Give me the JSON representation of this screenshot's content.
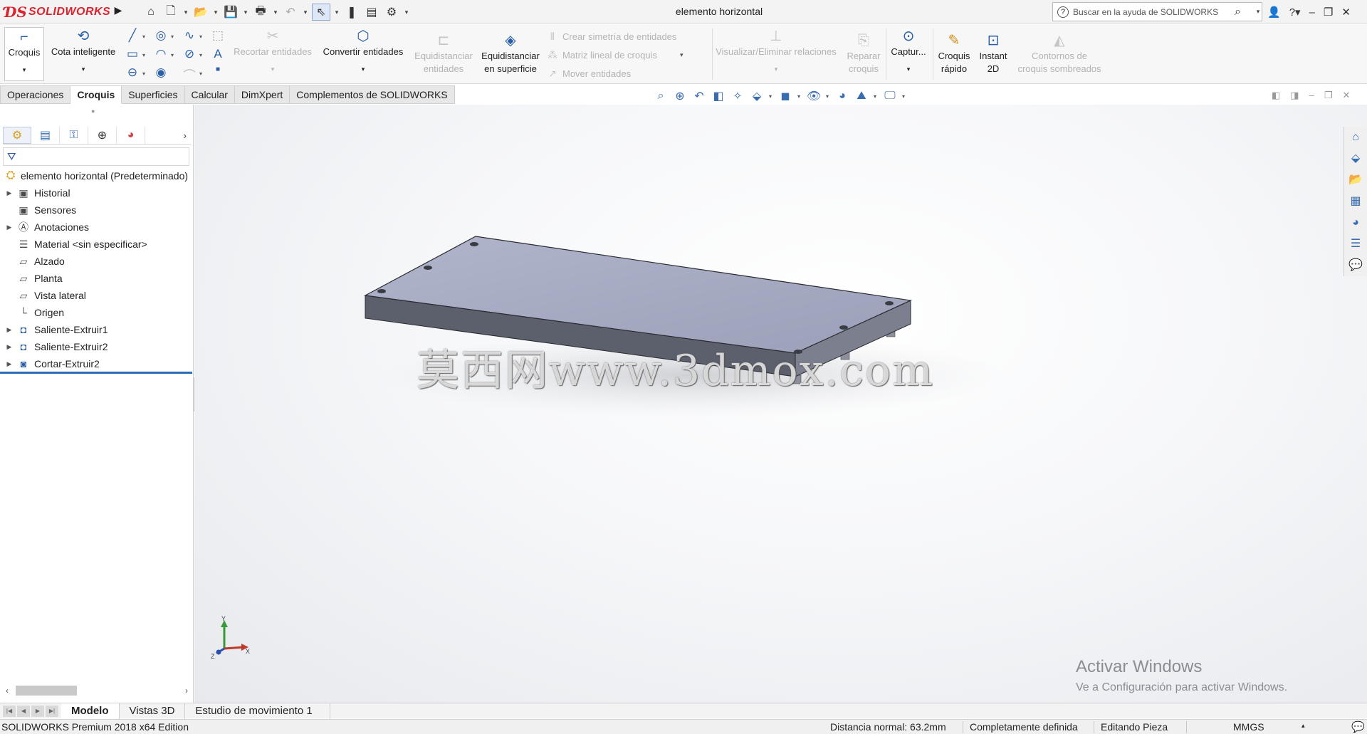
{
  "app": {
    "brand": "SOLIDWORKS",
    "document_title": "elemento horizontal",
    "search_placeholder": "Buscar en la ayuda de SOLIDWORKS"
  },
  "ribbon": {
    "croquis": "Croquis",
    "cota": "Cota inteligente",
    "recortar": "Recortar entidades",
    "convertir": "Convertir entidades",
    "equid_ent_1": "Equidistanciar",
    "equid_ent_2": "entidades",
    "equid_sup_1": "Equidistanciar",
    "equid_sup_2": "en superficie",
    "simetria": "Crear simetría de entidades",
    "matriz": "Matriz lineal de croquis",
    "mover": "Mover entidades",
    "relaciones": "Visualizar/Eliminar relaciones",
    "reparar_1": "Reparar",
    "reparar_2": "croquis",
    "captura": "Captur...",
    "rapido_1": "Croquis",
    "rapido_2": "rápido",
    "instant_1": "Instant",
    "instant_2": "2D",
    "contornos_1": "Contornos de",
    "contornos_2": "croquis sombreados"
  },
  "command_tabs": [
    "Operaciones",
    "Croquis",
    "Superficies",
    "Calcular",
    "DimXpert",
    "Complementos de SOLIDWORKS"
  ],
  "feature_tree": {
    "root": "elemento horizontal  (Predeterminado)",
    "items": [
      {
        "label": "Historial",
        "icon": "history-folder-icon",
        "expandable": true
      },
      {
        "label": "Sensores",
        "icon": "sensor-folder-icon",
        "expandable": false
      },
      {
        "label": "Anotaciones",
        "icon": "annotations-folder-icon",
        "expandable": true
      },
      {
        "label": "Material <sin especificar>",
        "icon": "material-icon",
        "expandable": false
      },
      {
        "label": "Alzado",
        "icon": "plane-icon",
        "expandable": false
      },
      {
        "label": "Planta",
        "icon": "plane-icon",
        "expandable": false
      },
      {
        "label": "Vista lateral",
        "icon": "plane-icon",
        "expandable": false
      },
      {
        "label": "Origen",
        "icon": "origin-icon",
        "expandable": false
      },
      {
        "label": "Saliente-Extruir1",
        "icon": "boss-extrude-icon",
        "expandable": true
      },
      {
        "label": "Saliente-Extruir2",
        "icon": "boss-extrude-icon",
        "expandable": true
      },
      {
        "label": "Cortar-Extruir2",
        "icon": "cut-extrude-icon",
        "expandable": true
      }
    ]
  },
  "viewport": {
    "watermark": "莫西网www.3dmox.com",
    "activate_title": "Activar Windows",
    "activate_sub": "Ve a Configuración para activar Windows.",
    "axis_x": "X",
    "axis_y": "Y",
    "axis_z": "Z",
    "model_colors": {
      "top": "#a3a8c0",
      "front": "#5c5f6c",
      "side": "#7c7f8e"
    }
  },
  "bottom_tabs": [
    "Modelo",
    "Vistas 3D",
    "Estudio de movimiento 1"
  ],
  "status": {
    "edition": "SOLIDWORKS Premium 2018 x64 Edition",
    "distance": "Distancia normal: 63.2mm",
    "definition": "Completamente definida",
    "mode": "Editando Pieza",
    "units": "MMGS"
  }
}
